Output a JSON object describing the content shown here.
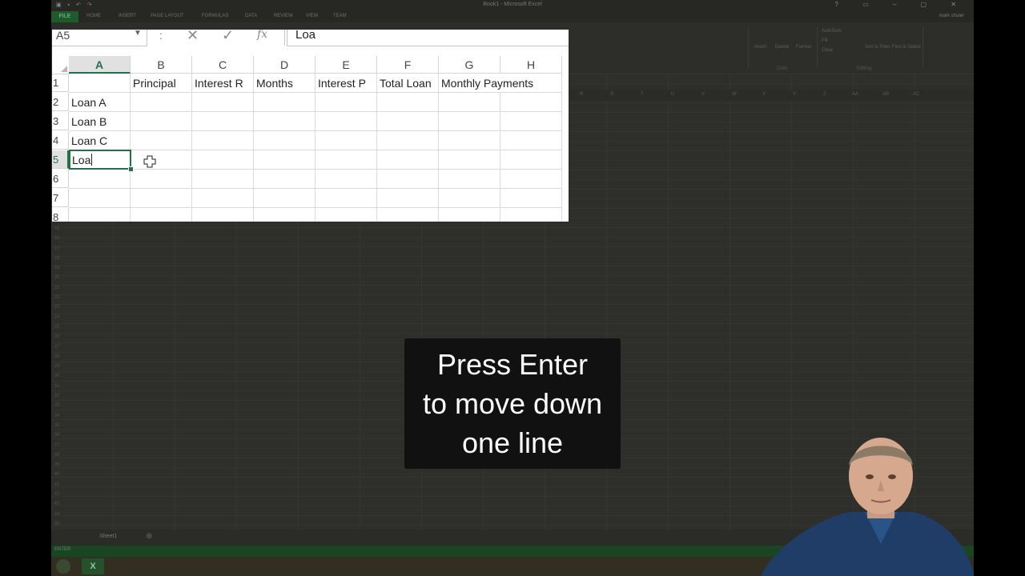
{
  "window": {
    "title": "Book1 - Microsoft Excel",
    "user": "mark shuler",
    "qat_icons": [
      "excel-logo-icon",
      "save-icon",
      "undo-icon",
      "redo-icon"
    ]
  },
  "ribbon": {
    "file_tab": "FILE",
    "tabs": [
      "HOME",
      "INSERT",
      "PAGE LAYOUT",
      "FORMULAS",
      "DATA",
      "REVIEW",
      "VIEW",
      "TEAM"
    ],
    "groups": [
      "Cells",
      "Editing"
    ],
    "buttons": [
      "Insert",
      "Delete",
      "Format",
      "AutoSum",
      "Fill",
      "Clear",
      "Sort & Filter",
      "Find & Select"
    ]
  },
  "formula_bar": {
    "name_box": "A5",
    "value": "Loa",
    "separator": ":",
    "fx_label": "fx"
  },
  "columns": [
    "A",
    "B",
    "C",
    "D",
    "E",
    "F",
    "G",
    "H"
  ],
  "active_column": "A",
  "rows": [
    "1",
    "2",
    "3",
    "4",
    "5",
    "6",
    "7",
    "8"
  ],
  "active_row": "5",
  "cells": {
    "B1": "Principal",
    "C1": "Interest R",
    "D1": "Months",
    "E1": "Interest P",
    "F1": "Total Loan",
    "G1": "Monthly Payments",
    "A2": "Loan A",
    "A3": "Loan B",
    "A4": "Loan C"
  },
  "editing_cell": {
    "ref": "A5",
    "text": "Loa"
  },
  "background_sheet": {
    "column_letters": [
      "R",
      "S",
      "T",
      "U",
      "V",
      "W",
      "X",
      "Y",
      "Z",
      "AA",
      "AB",
      "AC"
    ],
    "sheet_tab": "Sheet1",
    "status": "ENTER"
  },
  "caption": {
    "lines": [
      "Press Enter",
      "to move down",
      "one line"
    ]
  },
  "colors": {
    "excel_green": "#217346",
    "caption_bg": "#111111",
    "dim_background": "#2e2f2b"
  }
}
